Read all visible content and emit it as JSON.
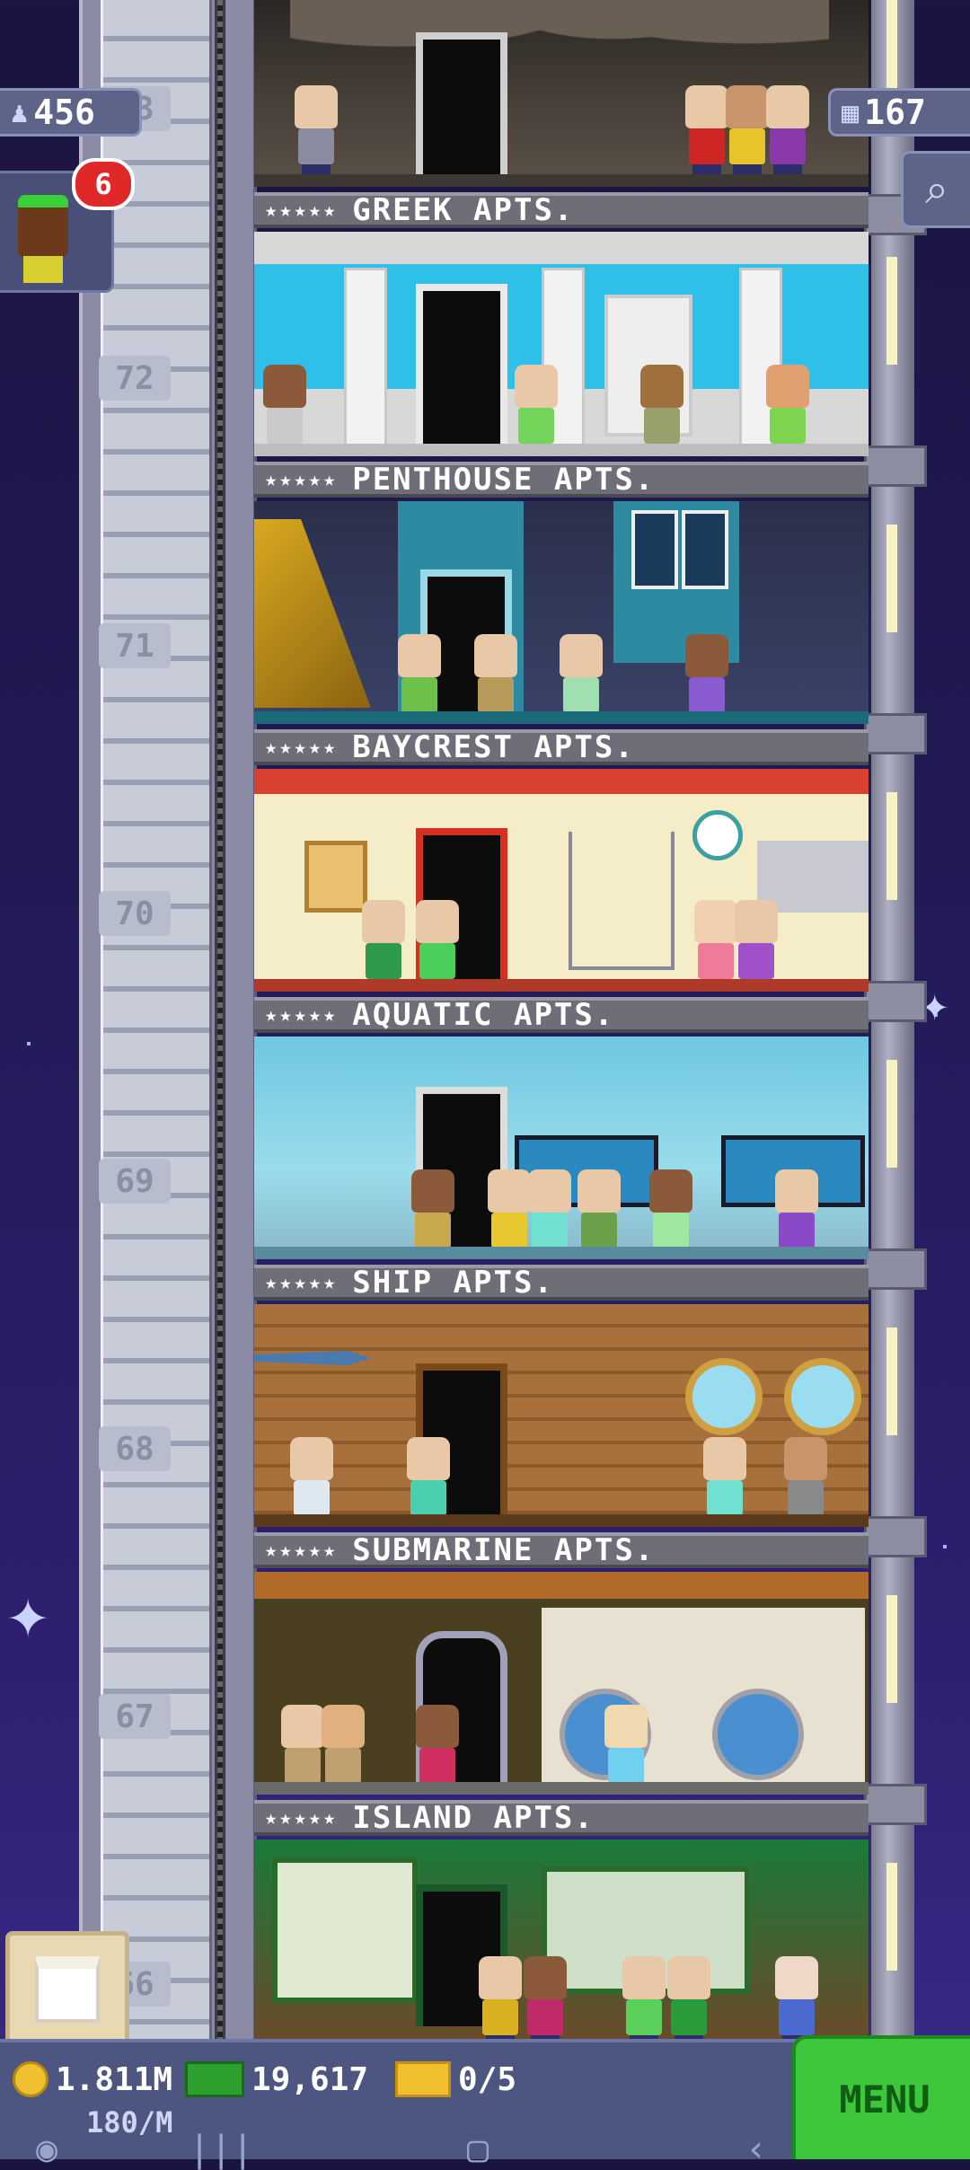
{
  "hud": {
    "population": "456",
    "floors": "167",
    "notification_count": "6"
  },
  "floors": [
    {
      "number": "73",
      "name": "",
      "theme": "cave"
    },
    {
      "number": "72",
      "name": "GREEK APTS.",
      "theme": "greek"
    },
    {
      "number": "71",
      "name": "PENTHOUSE APTS.",
      "theme": "penthouse"
    },
    {
      "number": "70",
      "name": "BAYCREST APTS.",
      "theme": "baycrest"
    },
    {
      "number": "69",
      "name": "AQUATIC APTS.",
      "theme": "aquatic"
    },
    {
      "number": "68",
      "name": "SHIP APTS.",
      "theme": "ship"
    },
    {
      "number": "67",
      "name": "SUBMARINE APTS.",
      "theme": "submarine"
    },
    {
      "number": "66",
      "name": "ISLAND APTS.",
      "theme": "island"
    }
  ],
  "labels": {
    "greek": "GREEK APTS.",
    "penthouse": "PENTHOUSE APTS.",
    "baycrest": "BAYCREST APTS.",
    "aquatic": "AQUATIC APTS.",
    "ship": "SHIP APTS.",
    "submarine": "SUBMARINE APTS.",
    "island": "ISLAND APTS.",
    "stars": "★★★★★"
  },
  "bottom": {
    "coins": "1.811M",
    "bux": "19,617",
    "tickets": "0/5",
    "rate": "180/M",
    "menu": "MENU"
  },
  "colors": {
    "menu_green": "#3ec63c",
    "hud_blue": "#5e6488",
    "notification_red": "#e02828"
  }
}
